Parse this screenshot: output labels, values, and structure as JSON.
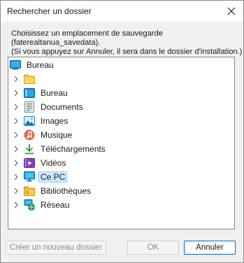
{
  "window": {
    "title": "Rechercher un dossier"
  },
  "instructions": {
    "line1": "Choisissez un emplacement de sauvegarde",
    "line2": "(faterealtanua_savedata).",
    "line3": "(Si vous appuyez sur Annuler, il sera dans le dossier d'installation.)"
  },
  "tree": {
    "root": {
      "label": "Bureau",
      "icon": "desktop-icon"
    },
    "items": [
      {
        "label": "",
        "icon": "folder-icon"
      },
      {
        "label": "Bureau",
        "icon": "desktop-icon"
      },
      {
        "label": "Documents",
        "icon": "documents-icon"
      },
      {
        "label": "Images",
        "icon": "pictures-icon"
      },
      {
        "label": "Musique",
        "icon": "music-icon"
      },
      {
        "label": "Téléchargements",
        "icon": "download-icon"
      },
      {
        "label": "Vidéos",
        "icon": "videos-icon"
      },
      {
        "label": "Ce PC",
        "icon": "computer-icon",
        "selected": true
      },
      {
        "label": "Bibliothèques",
        "icon": "libraries-icon"
      },
      {
        "label": "Réseau",
        "icon": "network-icon"
      }
    ]
  },
  "buttons": {
    "new_folder": "Créer un nouveau dossier",
    "ok": "OK",
    "cancel": "Annuler"
  },
  "colors": {
    "accent": "#0067c0",
    "selection": "#cce8ff",
    "dialog_background": "#f0f0f0"
  }
}
